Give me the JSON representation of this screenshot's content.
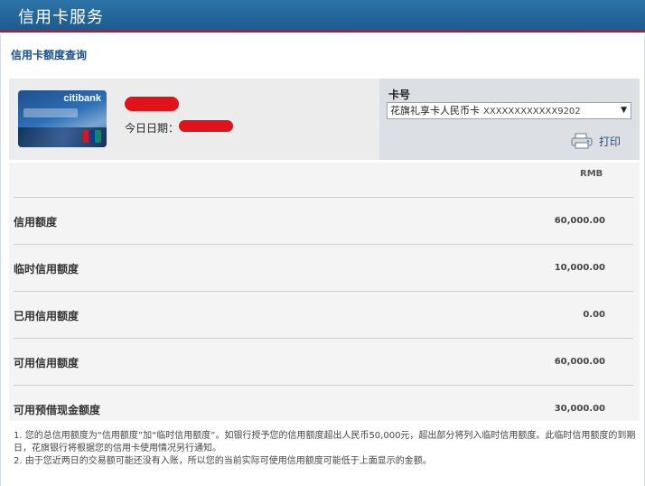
{
  "header": {
    "title": "信用卡服务"
  },
  "page": {
    "subtitle": "信用卡额度查询"
  },
  "card_image": {
    "brand": "citibank"
  },
  "info": {
    "date_label": "今日日期："
  },
  "card_selector": {
    "label": "卡号",
    "selected_name": "花旗礼享卡人民币卡",
    "selected_number": "XXXXXXXXXXXX9202"
  },
  "print": {
    "label": "打印"
  },
  "table": {
    "currency": "RMB",
    "rows": [
      {
        "label": "信用额度",
        "value": "60,000.00"
      },
      {
        "label": "临时信用额度",
        "value": "10,000.00"
      },
      {
        "label": "已用信用额度",
        "value": "0.00"
      },
      {
        "label": "可用信用额度",
        "value": "60,000.00"
      },
      {
        "label": "可用预借现金额度",
        "value": "30,000.00"
      }
    ]
  },
  "notes": {
    "line1": "1. 您的总信用额度为“信用额度”加“临时信用额度”。如银行授予您的信用额度超出人民币50,000元，超出部分将列入临时信用额度。此临时信用额度的到期日，花旗银行将根据您的信用卡使用情况另行通知。",
    "line2": "2. 由于您近两日的交易额可能还没有入账，所以您的当前实际可使用信用额度可能低于上面显示的金额。"
  },
  "colors": {
    "header_bg": "#1c5a8c",
    "accent_red": "#c8102e",
    "link_blue": "#1a4f8a"
  }
}
